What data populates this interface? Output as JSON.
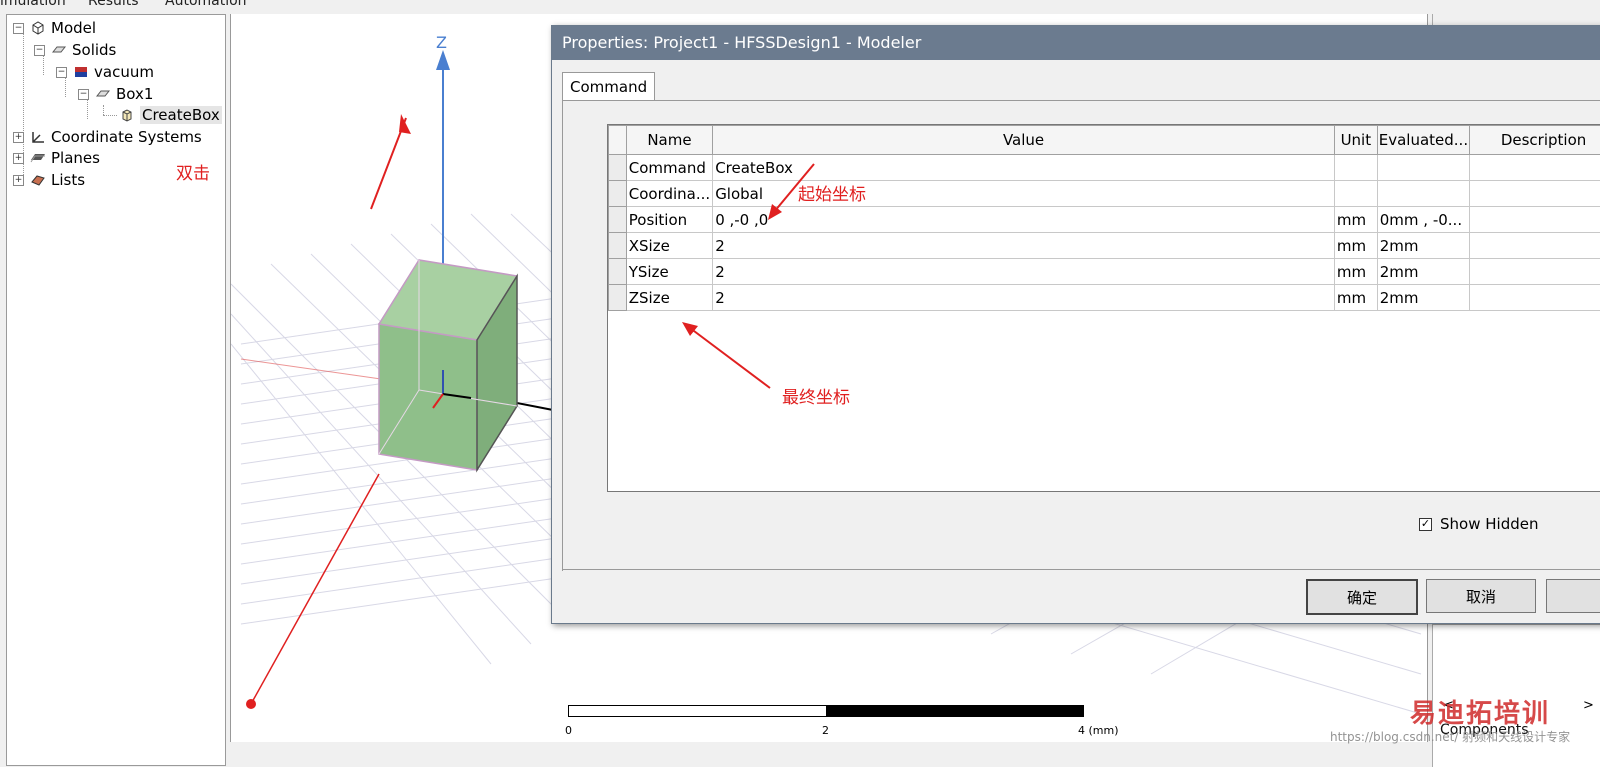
{
  "menu": {
    "items": [
      "imulation",
      "Results",
      "Automation"
    ]
  },
  "tree": {
    "model": "Model",
    "solids": "Solids",
    "vacuum": "vacuum",
    "box1": "Box1",
    "createbox": "CreateBox",
    "coord_systems": "Coordinate Systems",
    "planes": "Planes",
    "lists": "Lists",
    "expand_minus": "−",
    "expand_plus": "+"
  },
  "viewport": {
    "axis_z": "Z"
  },
  "scale": {
    "l0": "0",
    "l2": "2",
    "l4": "4 (mm)"
  },
  "dialog": {
    "title": "Properties: Project1 - HFSSDesign1 - Modeler",
    "tab": "Command",
    "columns": [
      "Name",
      "Value",
      "Unit",
      "Evaluated...",
      "Description"
    ],
    "rows": [
      {
        "name": "Command",
        "value": "CreateBox",
        "unit": "",
        "evaluated": ""
      },
      {
        "name": "Coordina...",
        "value": "Global",
        "unit": "",
        "evaluated": ""
      },
      {
        "name": "Position",
        "value": "0 ,-0 ,0",
        "unit": "mm",
        "evaluated": "0mm , -0..."
      },
      {
        "name": "XSize",
        "value": "2",
        "unit": "mm",
        "evaluated": "2mm"
      },
      {
        "name": "YSize",
        "value": "2",
        "unit": "mm",
        "evaluated": "2mm"
      },
      {
        "name": "ZSize",
        "value": "2",
        "unit": "mm",
        "evaluated": "2mm"
      }
    ],
    "show_hidden": "Show Hidden",
    "ok": "确定",
    "cancel": "取消"
  },
  "annotations": {
    "double_click": "双击",
    "start_coord": "起始坐标",
    "end_coord": "最终坐标"
  },
  "right_panel": {
    "components": "Components",
    "scroll_left": "<",
    "scroll_right": ">"
  },
  "watermark": {
    "text": "易迪拓培训",
    "sub": "https://blog.csdn.net/ 射频和天线设计专家"
  },
  "colors": {
    "accent_red": "#e02020",
    "titlebar": "#6b7b8f",
    "box_fill": "#8fbf8a"
  }
}
